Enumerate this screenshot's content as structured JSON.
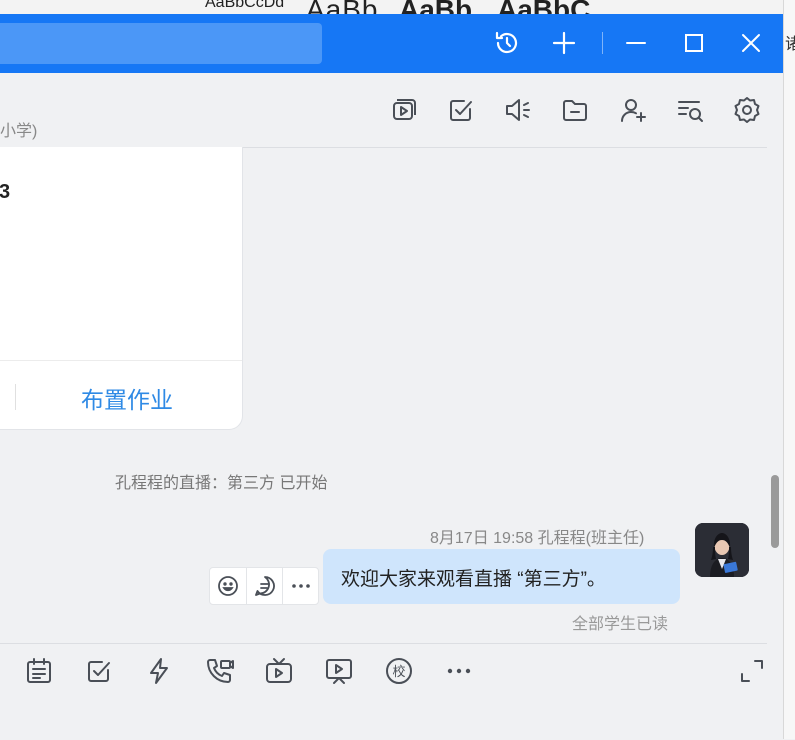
{
  "ribbon": {
    "styles": [
      "AaBbCcDd",
      "AaBb",
      "AaBb",
      "AaBbC"
    ],
    "edge_char": "诸"
  },
  "titlebar": {
    "search_value": "",
    "icons": [
      "history-icon",
      "plus-icon",
      "minimize-icon",
      "maximize-icon",
      "close-icon"
    ]
  },
  "chat_header": {
    "subtitle": "小学)",
    "icons": [
      "screen-share-icon",
      "task-check-icon",
      "announcement-icon",
      "folder-icon",
      "add-member-icon",
      "search-history-icon",
      "settings-icon"
    ]
  },
  "card": {
    "glyph": "3",
    "action_label": "布置作业"
  },
  "messages": {
    "live_notice": "孔程程的直播：第三方 已开始",
    "meta": "8月17日 19:58  孔程程(班主任)",
    "text": "欢迎大家来观看直播 “第三方”。",
    "read_status": "全部学生已读"
  },
  "composer": {
    "icons": [
      "notice-icon",
      "homework-icon",
      "quick-icon",
      "call-icon",
      "live-tv-icon",
      "video-icon",
      "school-icon",
      "more-icon",
      "expand-icon"
    ],
    "school_glyph": "校"
  },
  "colors": {
    "titlebar": "#1677f5",
    "bubble": "#cfe5fc",
    "link": "#2f8ae5"
  }
}
